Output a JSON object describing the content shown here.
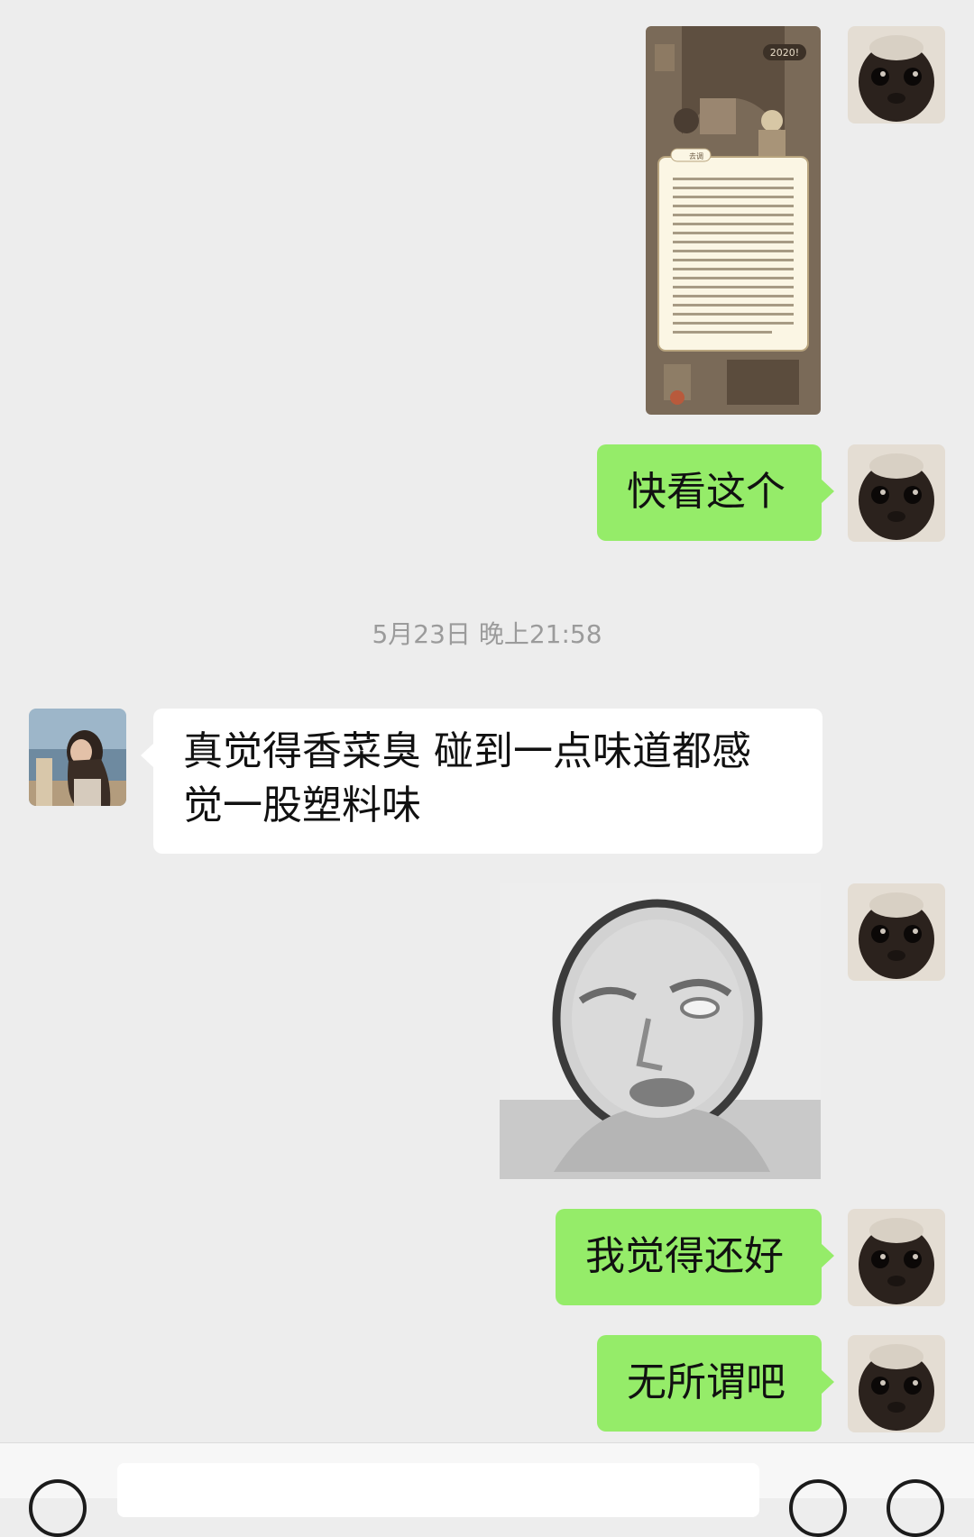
{
  "chat": {
    "timestamp": "5月23日 晚上21:58",
    "messages": [
      {
        "id": "m1",
        "side": "right",
        "type": "image",
        "avatar_icon": "black-cat-avatar-icon",
        "image_icon": "game-notice-screenshot-icon",
        "badge": "2020!",
        "tag": "去调"
      },
      {
        "id": "m2",
        "side": "right",
        "type": "text",
        "avatar_icon": "black-cat-avatar-icon",
        "text": "快看这个"
      },
      {
        "id": "m3",
        "side": "left",
        "type": "text",
        "avatar_icon": "woman-seaside-avatar-icon",
        "lines": [
          "真觉得香菜臭  碰到一点味道都感",
          "觉一股塑料味"
        ]
      },
      {
        "id": "m4",
        "side": "right",
        "type": "image",
        "avatar_icon": "black-cat-avatar-icon",
        "image_icon": "rolling-eyes-meme-icon"
      },
      {
        "id": "m5",
        "side": "right",
        "type": "text",
        "avatar_icon": "black-cat-avatar-icon",
        "text": "我觉得还好"
      },
      {
        "id": "m6",
        "side": "right",
        "type": "text",
        "avatar_icon": "black-cat-avatar-icon",
        "text": "无所谓吧"
      }
    ]
  },
  "colors": {
    "background": "#ededed",
    "bubble_self": "#95ec69",
    "bubble_other": "#ffffff",
    "timestamp_text": "#9b9b9b"
  },
  "input_bar": {
    "left_icon": "voice-icon",
    "right_icons": [
      "emoji-icon",
      "plus-icon"
    ]
  }
}
